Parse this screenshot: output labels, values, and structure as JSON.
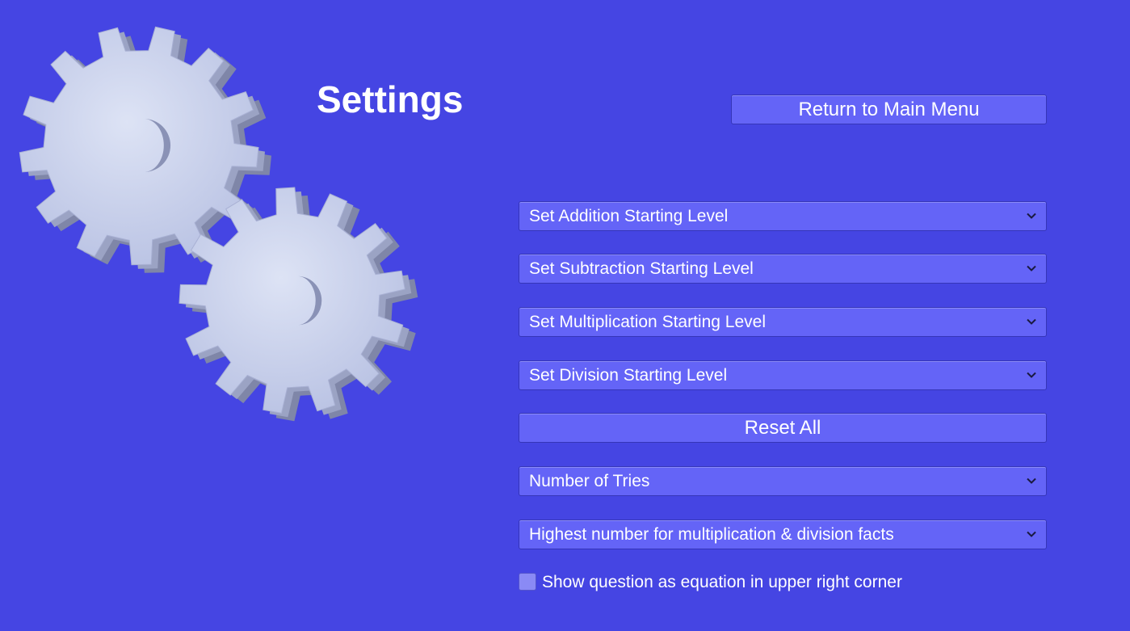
{
  "title": "Settings",
  "return_button": "Return to Main Menu",
  "dropdowns": [
    {
      "label": "Set Addition Starting Level",
      "icon": "chevron-down-icon"
    },
    {
      "label": "Set Subtraction Starting Level",
      "icon": "chevron-down-icon"
    },
    {
      "label": "Set Multiplication Starting Level",
      "icon": "chevron-down-icon"
    },
    {
      "label": "Set Division Starting Level",
      "icon": "chevron-down-icon"
    }
  ],
  "reset_button": "Reset All",
  "tries_dropdown": {
    "label": "Number of Tries",
    "icon": "chevron-down-icon"
  },
  "highest_dropdown": {
    "label": "Highest number for multiplication & division facts",
    "icon": "chevron-down-icon"
  },
  "equation_checkbox": {
    "label": "Show question as equation in upper right corner",
    "checked": false
  },
  "colors": {
    "background": "#4545e3",
    "button": "#6464f7",
    "gear": "#c8d0ec",
    "text": "#ffffff"
  },
  "decoration": {
    "icon": "gears-icon"
  }
}
